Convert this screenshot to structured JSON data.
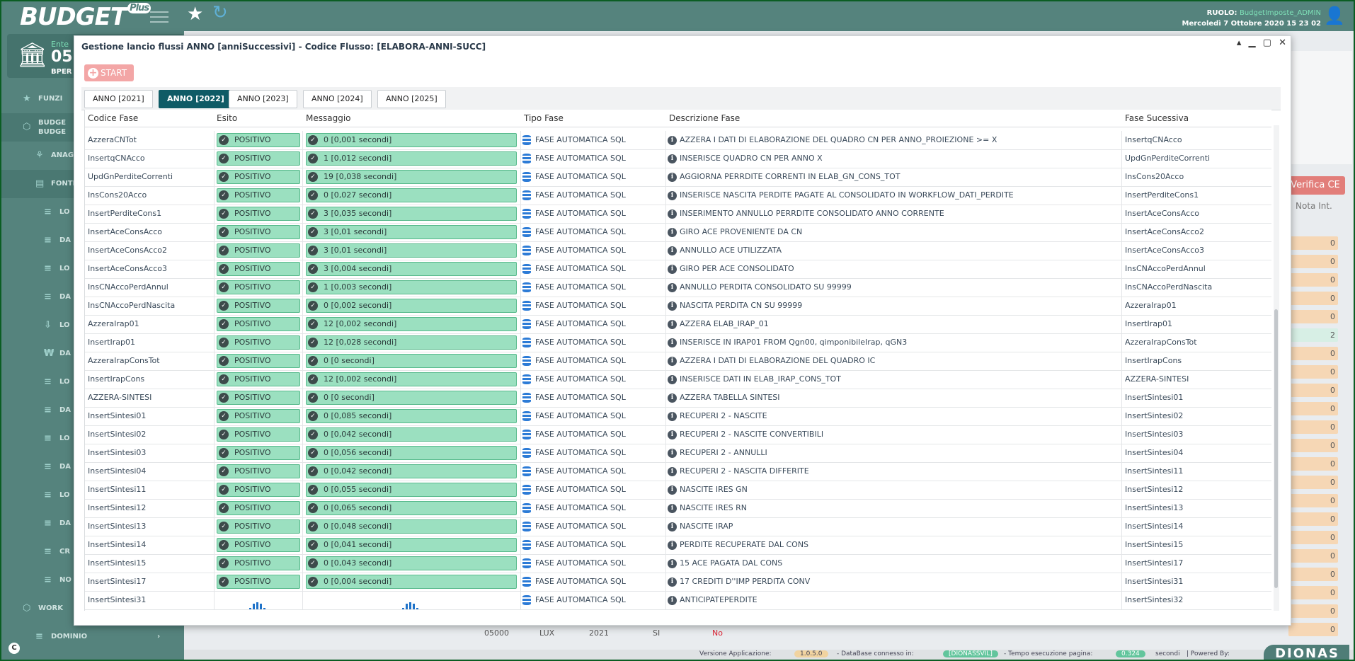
{
  "topbar": {
    "logo": "BUDGET",
    "logo_badge": "Plus",
    "role_label": "RUOLO:",
    "role_value": "BudgetImposte_ADMIN",
    "datetime": "Mercoledì 7 Ottobre 2020 15 23 02"
  },
  "sidebar": {
    "ente_label": "Ente",
    "ente_code": "05",
    "ente_name": "BPER",
    "items": [
      {
        "label": "FUNZI",
        "icon": "star-icon"
      },
      {
        "label": "BUDGE\nBUDGE",
        "icon": "cube-icon"
      },
      {
        "label": "ANAG",
        "icon": "filter-icon"
      },
      {
        "label": "FONTI",
        "icon": "file-icon"
      },
      {
        "label": "LO",
        "icon": "list-icon"
      },
      {
        "label": "DA",
        "icon": "list-icon"
      },
      {
        "label": "LO",
        "icon": "list-icon"
      },
      {
        "label": "DA",
        "icon": "list-icon"
      },
      {
        "label": "LO",
        "icon": "download-icon"
      },
      {
        "label": "DA",
        "icon": "won-icon"
      },
      {
        "label": "LO",
        "icon": "list-icon"
      },
      {
        "label": "DA",
        "icon": "list-icon"
      },
      {
        "label": "LO",
        "icon": "list-icon"
      },
      {
        "label": "DA",
        "icon": "list-icon"
      },
      {
        "label": "LO",
        "icon": "list-icon"
      },
      {
        "label": "DA",
        "icon": "list-icon"
      },
      {
        "label": "CR",
        "icon": "list-icon"
      },
      {
        "label": "NO",
        "icon": "list-icon"
      },
      {
        "label": "WORK",
        "icon": "cube-icon"
      },
      {
        "label": "DOMINIO",
        "icon": "list-icon"
      }
    ],
    "corner": "C"
  },
  "background": {
    "verifica": "Verifica CE",
    "nota": "Nota Int.",
    "values": [
      "0",
      "0",
      "0",
      "0",
      "0",
      "2",
      "0",
      "0",
      "0",
      "0",
      "0",
      "0",
      "0",
      "0",
      "0",
      "0",
      "0",
      "0",
      "0",
      "0",
      "0",
      "0"
    ],
    "bottom_row": [
      "05000",
      "LUX",
      "2021",
      "SI",
      "No"
    ],
    "status": {
      "versione_label": "Versione Applicazione:",
      "versione": "1.0.5.0",
      "db_label": "- DataBase connesso in:",
      "db": "[DIONASSVIL]",
      "tempo_label": "- Tempo esecuzione pagina:",
      "tempo": "0.324",
      "secondi": "secondi",
      "powered": "| Powered By:"
    },
    "brand": "DIONAS"
  },
  "modal": {
    "title": "Gestione lancio flussi ANNO [anniSuccessivi] - Codice Flusso: [ELABORA-ANNI-SUCC]",
    "start": "START",
    "tabs": [
      "ANNO [2021]",
      "ANNO [2022]",
      "ANNO [2023]",
      "ANNO [2024]",
      "ANNO [2025]"
    ],
    "active_tab": 1,
    "columns": [
      "Codice Fase",
      "Esito",
      "Messaggio",
      "Tipo Fase",
      "Descrizione Fase",
      "Fase Sucessiva"
    ],
    "rows": [
      [
        "AzzeraCNTot",
        "POSITIVO",
        "0 [0,001 secondi]",
        "FASE AUTOMATICA SQL",
        "AZZERA I DATI DI ELABORAZIONE DEL QUADRO CN PER ANNO_PROIEZIONE >= X",
        "InsertqCNAcco"
      ],
      [
        "InsertqCNAcco",
        "POSITIVO",
        "1 [0,012 secondi]",
        "FASE AUTOMATICA SQL",
        "INSERISCE QUADRO CN PER ANNO X",
        "UpdGnPerditeCorrenti"
      ],
      [
        "UpdGnPerditeCorrenti",
        "POSITIVO",
        "19 [0,038 secondi]",
        "FASE AUTOMATICA SQL",
        "AGGIORNA PERRDITE CORRENTI IN ELAB_GN_CONS_TOT",
        "InsCons20Acco"
      ],
      [
        "InsCons20Acco",
        "POSITIVO",
        "0 [0,027 secondi]",
        "FASE AUTOMATICA SQL",
        "INSERISCE NASCITA PERDITE PAGATE AL CONSOLIDATO IN WORKFLOW_DATI_PERDITE",
        "InsertPerditeCons1"
      ],
      [
        "InsertPerditeCons1",
        "POSITIVO",
        "3 [0,035 secondi]",
        "FASE AUTOMATICA SQL",
        "INSERIMENTO ANNULLO PERRDITE CONSOLIDATO ANNO CORRENTE",
        "InsertAceConsAcco"
      ],
      [
        "InsertAceConsAcco",
        "POSITIVO",
        "3 [0,01 secondi]",
        "FASE AUTOMATICA SQL",
        "GIRO ACE PROVENIENTE DA CN",
        "InsertAceConsAcco2"
      ],
      [
        "InsertAceConsAcco2",
        "POSITIVO",
        "3 [0,01 secondi]",
        "FASE AUTOMATICA SQL",
        "ANNULLO ACE UTILIZZATA",
        "InsertAceConsAcco3"
      ],
      [
        "InsertAceConsAcco3",
        "POSITIVO",
        "3 [0,004 secondi]",
        "FASE AUTOMATICA SQL",
        "GIRO PER ACE CONSOLIDATO",
        "InsCNAccoPerdAnnul"
      ],
      [
        "InsCNAccoPerdAnnul",
        "POSITIVO",
        "1 [0,003 secondi]",
        "FASE AUTOMATICA SQL",
        "ANNULLO PERDITA CONSOLIDATO SU 99999",
        "InsCNAccoPerdNascita"
      ],
      [
        "InsCNAccoPerdNascita",
        "POSITIVO",
        "0 [0,002 secondi]",
        "FASE AUTOMATICA SQL",
        "NASCITA PERDITA CN SU 99999",
        "AzzeraIrap01"
      ],
      [
        "AzzeraIrap01",
        "POSITIVO",
        "12 [0,002 secondi]",
        "FASE AUTOMATICA SQL",
        "AZZERA ELAB_IRAP_01",
        "InsertIrap01"
      ],
      [
        "InsertIrap01",
        "POSITIVO",
        "12 [0,028 secondi]",
        "FASE AUTOMATICA SQL",
        "INSERISCE IN IRAP01 FROM Qgn00, qimponibileIrap, qGN3",
        "AzzeraIrapConsTot"
      ],
      [
        "AzzeraIrapConsTot",
        "POSITIVO",
        "0 [0 secondi]",
        "FASE AUTOMATICA SQL",
        "AZZERA I DATI DI ELABORAZIONE DEL QUADRO IC",
        "InsertIrapCons"
      ],
      [
        "InsertIrapCons",
        "POSITIVO",
        "12 [0,002 secondi]",
        "FASE AUTOMATICA SQL",
        "INSERISCE DATI IN ELAB_IRAP_CONS_TOT",
        "AZZERA-SINTESI"
      ],
      [
        "AZZERA-SINTESI",
        "POSITIVO",
        "0 [0 secondi]",
        "FASE AUTOMATICA SQL",
        "AZZERA TABELLA SINTESI",
        "InsertSintesi01"
      ],
      [
        "InsertSintesi01",
        "POSITIVO",
        "0 [0,085 secondi]",
        "FASE AUTOMATICA SQL",
        "RECUPERI 2 - NASCITE",
        "InsertSintesi02"
      ],
      [
        "InsertSintesi02",
        "POSITIVO",
        "0 [0,042 secondi]",
        "FASE AUTOMATICA SQL",
        "RECUPERI 2 - NASCITE CONVERTIBILI",
        "InsertSintesi03"
      ],
      [
        "InsertSintesi03",
        "POSITIVO",
        "0 [0,056 secondi]",
        "FASE AUTOMATICA SQL",
        "RECUPERI 2 - ANNULLI",
        "InsertSintesi04"
      ],
      [
        "InsertSintesi04",
        "POSITIVO",
        "0 [0,042 secondi]",
        "FASE AUTOMATICA SQL",
        "RECUPERI 2 - NASCITA DIFFERITE",
        "InsertSintesi11"
      ],
      [
        "InsertSintesi11",
        "POSITIVO",
        "0 [0,055 secondi]",
        "FASE AUTOMATICA SQL",
        "NASCITE IRES GN",
        "InsertSintesi12"
      ],
      [
        "InsertSintesi12",
        "POSITIVO",
        "0 [0,065 secondi]",
        "FASE AUTOMATICA SQL",
        "NASCITE IRES RN",
        "InsertSintesi13"
      ],
      [
        "InsertSintesi13",
        "POSITIVO",
        "0 [0,048 secondi]",
        "FASE AUTOMATICA SQL",
        "NASCITE IRAP",
        "InsertSintesi14"
      ],
      [
        "InsertSintesi14",
        "POSITIVO",
        "0 [0,041 secondi]",
        "FASE AUTOMATICA SQL",
        "PERDITE RECUPERATE DAL CONS",
        "InsertSintesi15"
      ],
      [
        "InsertSintesi15",
        "POSITIVO",
        "0 [0,043 secondi]",
        "FASE AUTOMATICA SQL",
        "15 ACE PAGATA DAL CONS",
        "InsertSintesi17"
      ],
      [
        "InsertSintesi17",
        "POSITIVO",
        "0 [0,004 secondi]",
        "FASE AUTOMATICA SQL",
        "17 CREDITI D''IMP PERDITA CONV",
        "InsertSintesi31"
      ],
      [
        "InsertSintesi31",
        "",
        "",
        "FASE AUTOMATICA SQL",
        "ANTICIPATEPERDITE",
        "InsertSintesi32"
      ]
    ]
  }
}
